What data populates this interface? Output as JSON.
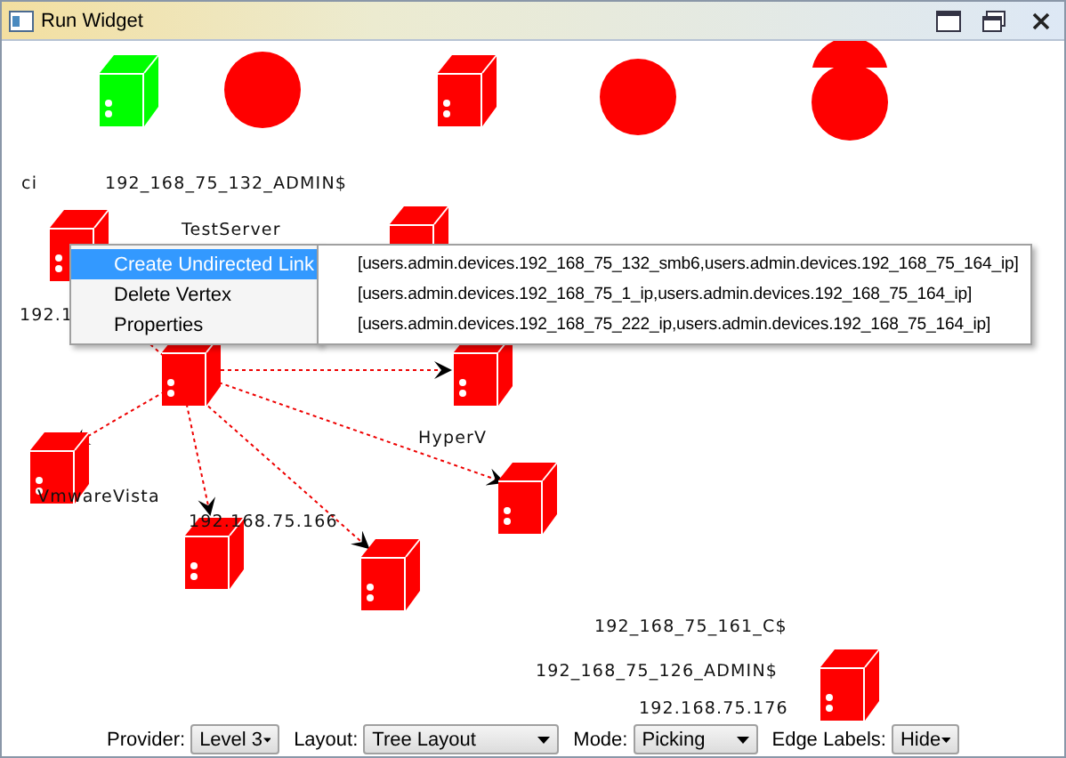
{
  "window": {
    "title": "Run Widget"
  },
  "nodes": [
    {
      "kind": "server",
      "color": "#00ff00"
    },
    {
      "kind": "circle",
      "color": "#ff0000"
    },
    {
      "kind": "server",
      "color": "#ff0000"
    },
    {
      "kind": "circle",
      "color": "#ff0000"
    },
    {
      "kind": "circle",
      "color": "#ff0000"
    },
    {
      "kind": "circle",
      "color": "#ff0000"
    },
    {
      "kind": "server",
      "color": "#ff0000"
    },
    {
      "kind": "server",
      "color": "#ff0000"
    },
    {
      "kind": "server",
      "color": "#ff0000"
    },
    {
      "kind": "server",
      "color": "#ff0000"
    },
    {
      "kind": "server",
      "color": "#ff0000"
    },
    {
      "kind": "server",
      "color": "#ff0000"
    },
    {
      "kind": "server",
      "color": "#ff0000"
    },
    {
      "kind": "server",
      "color": "#ff0000"
    },
    {
      "kind": "server",
      "color": "#ff0000"
    }
  ],
  "labels": [
    "ci",
    "192_168_75_132_ADMIN$",
    "TestServer",
    "192.1",
    "HyperV",
    "VmwareVista",
    "192.168.75.166",
    "192_168_75_161_C$",
    "192_168_75_126_ADMIN$",
    "192.168.75.176"
  ],
  "context_menu": {
    "items": [
      {
        "label": "Create Undirected Link",
        "selected": true,
        "has_submenu": true
      },
      {
        "label": "Delete Vertex",
        "selected": false,
        "has_submenu": false
      },
      {
        "label": "Properties",
        "selected": false,
        "has_submenu": false
      }
    ],
    "submenu": [
      "[users.admin.devices.192_168_75_132_smb6,users.admin.devices.192_168_75_164_ip]",
      "[users.admin.devices.192_168_75_1_ip,users.admin.devices.192_168_75_164_ip]",
      "[users.admin.devices.192_168_75_222_ip,users.admin.devices.192_168_75_164_ip]"
    ]
  },
  "toolbar": [
    {
      "label": "Provider:",
      "value": "Level 3"
    },
    {
      "label": "Layout:",
      "value": "Tree Layout"
    },
    {
      "label": "Mode:",
      "value": "Picking"
    },
    {
      "label": "Edge Labels:",
      "value": "Hide"
    }
  ]
}
